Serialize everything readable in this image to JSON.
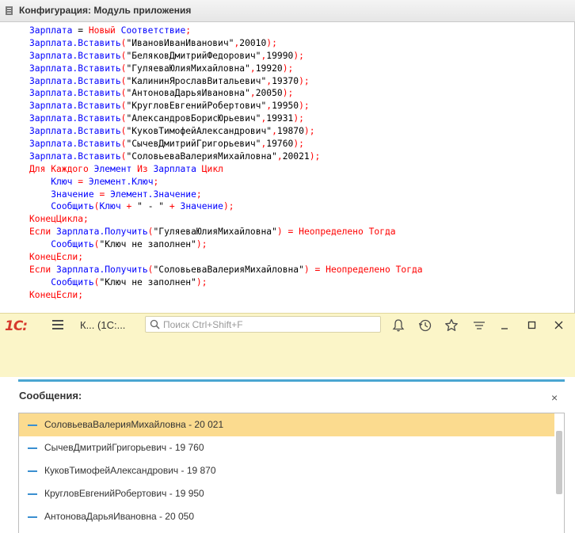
{
  "configurator": {
    "title": "Конфигурация: Модуль приложения",
    "code_lines": [
      [
        {
          "c": "id",
          "t": "Зарплата"
        },
        {
          "c": "st",
          "t": " = "
        },
        {
          "c": "kw",
          "t": "Новый"
        },
        {
          "c": "st",
          "t": " "
        },
        {
          "c": "id",
          "t": "Соответствие"
        },
        {
          "c": "kw",
          "t": ";"
        }
      ],
      [
        {
          "c": "id",
          "t": "Зарплата.Вставить"
        },
        {
          "c": "kw",
          "t": "("
        },
        {
          "c": "st",
          "t": "\"ИвановИванИванович\""
        },
        {
          "c": "kw",
          "t": ","
        },
        {
          "c": "nm",
          "t": "20010"
        },
        {
          "c": "kw",
          "t": ");"
        }
      ],
      [
        {
          "c": "id",
          "t": "Зарплата.Вставить"
        },
        {
          "c": "kw",
          "t": "("
        },
        {
          "c": "st",
          "t": "\"БеляковДмитрийФедорович\""
        },
        {
          "c": "kw",
          "t": ","
        },
        {
          "c": "nm",
          "t": "19990"
        },
        {
          "c": "kw",
          "t": ");"
        }
      ],
      [
        {
          "c": "id",
          "t": "Зарплата.Вставить"
        },
        {
          "c": "kw",
          "t": "("
        },
        {
          "c": "st",
          "t": "\"ГуляеваЮлияМихайловна\""
        },
        {
          "c": "kw",
          "t": ","
        },
        {
          "c": "nm",
          "t": "19920"
        },
        {
          "c": "kw",
          "t": ");"
        }
      ],
      [
        {
          "c": "id",
          "t": "Зарплата.Вставить"
        },
        {
          "c": "kw",
          "t": "("
        },
        {
          "c": "st",
          "t": "\"КалининЯрославВитальевич\""
        },
        {
          "c": "kw",
          "t": ","
        },
        {
          "c": "nm",
          "t": "19370"
        },
        {
          "c": "kw",
          "t": ");"
        }
      ],
      [
        {
          "c": "id",
          "t": "Зарплата.Вставить"
        },
        {
          "c": "kw",
          "t": "("
        },
        {
          "c": "st",
          "t": "\"АнтоноваДарьяИвановна\""
        },
        {
          "c": "kw",
          "t": ","
        },
        {
          "c": "nm",
          "t": "20050"
        },
        {
          "c": "kw",
          "t": ");"
        }
      ],
      [
        {
          "c": "id",
          "t": "Зарплата.Вставить"
        },
        {
          "c": "kw",
          "t": "("
        },
        {
          "c": "st",
          "t": "\"КругловЕвгенийРобертович\""
        },
        {
          "c": "kw",
          "t": ","
        },
        {
          "c": "nm",
          "t": "19950"
        },
        {
          "c": "kw",
          "t": ");"
        }
      ],
      [
        {
          "c": "id",
          "t": "Зарплата.Вставить"
        },
        {
          "c": "kw",
          "t": "("
        },
        {
          "c": "st",
          "t": "\"АлександровБорисЮрьевич\""
        },
        {
          "c": "kw",
          "t": ","
        },
        {
          "c": "nm",
          "t": "19931"
        },
        {
          "c": "kw",
          "t": ");"
        }
      ],
      [
        {
          "c": "id",
          "t": "Зарплата.Вставить"
        },
        {
          "c": "kw",
          "t": "("
        },
        {
          "c": "st",
          "t": "\"КуковТимофейАлександрович\""
        },
        {
          "c": "kw",
          "t": ","
        },
        {
          "c": "nm",
          "t": "19870"
        },
        {
          "c": "kw",
          "t": ");"
        }
      ],
      [
        {
          "c": "id",
          "t": "Зарплата.Вставить"
        },
        {
          "c": "kw",
          "t": "("
        },
        {
          "c": "st",
          "t": "\"СычевДмитрийГригорьевич\""
        },
        {
          "c": "kw",
          "t": ","
        },
        {
          "c": "nm",
          "t": "19760"
        },
        {
          "c": "kw",
          "t": ");"
        }
      ],
      [
        {
          "c": "id",
          "t": "Зарплата.Вставить"
        },
        {
          "c": "kw",
          "t": "("
        },
        {
          "c": "st",
          "t": "\"СоловьеваВалерияМихайловна\""
        },
        {
          "c": "kw",
          "t": ","
        },
        {
          "c": "nm",
          "t": "20021"
        },
        {
          "c": "kw",
          "t": ");"
        }
      ],
      [
        {
          "c": "kw",
          "t": "Для Каждого"
        },
        {
          "c": "st",
          "t": " "
        },
        {
          "c": "id",
          "t": "Элемент"
        },
        {
          "c": "st",
          "t": " "
        },
        {
          "c": "kw",
          "t": "Из"
        },
        {
          "c": "st",
          "t": " "
        },
        {
          "c": "id",
          "t": "Зарплата"
        },
        {
          "c": "st",
          "t": " "
        },
        {
          "c": "kw",
          "t": "Цикл"
        }
      ],
      [
        {
          "c": "st",
          "t": "    "
        },
        {
          "c": "id",
          "t": "Ключ"
        },
        {
          "c": "st",
          "t": " "
        },
        {
          "c": "kw",
          "t": "="
        },
        {
          "c": "st",
          "t": " "
        },
        {
          "c": "id",
          "t": "Элемент.Ключ"
        },
        {
          "c": "kw",
          "t": ";"
        }
      ],
      [
        {
          "c": "st",
          "t": "    "
        },
        {
          "c": "id",
          "t": "Значение"
        },
        {
          "c": "st",
          "t": " "
        },
        {
          "c": "kw",
          "t": "="
        },
        {
          "c": "st",
          "t": " "
        },
        {
          "c": "id",
          "t": "Элемент.Значение"
        },
        {
          "c": "kw",
          "t": ";"
        }
      ],
      [
        {
          "c": "st",
          "t": "    "
        },
        {
          "c": "id",
          "t": "Сообщить"
        },
        {
          "c": "kw",
          "t": "("
        },
        {
          "c": "id",
          "t": "Ключ"
        },
        {
          "c": "st",
          "t": " "
        },
        {
          "c": "kw",
          "t": "+"
        },
        {
          "c": "st",
          "t": " \" - \" "
        },
        {
          "c": "kw",
          "t": "+"
        },
        {
          "c": "st",
          "t": " "
        },
        {
          "c": "id",
          "t": "Значение"
        },
        {
          "c": "kw",
          "t": ");"
        }
      ],
      [
        {
          "c": "kw",
          "t": "КонецЦикла;"
        }
      ],
      [
        {
          "c": "kw",
          "t": "Если"
        },
        {
          "c": "st",
          "t": " "
        },
        {
          "c": "id",
          "t": "Зарплата.Получить"
        },
        {
          "c": "kw",
          "t": "("
        },
        {
          "c": "st",
          "t": "\"ГуляеваЮлияМихайловна\""
        },
        {
          "c": "kw",
          "t": ")"
        },
        {
          "c": "st",
          "t": " "
        },
        {
          "c": "kw",
          "t": "="
        },
        {
          "c": "st",
          "t": " "
        },
        {
          "c": "kw",
          "t": "Неопределено"
        },
        {
          "c": "st",
          "t": " "
        },
        {
          "c": "kw",
          "t": "Тогда"
        }
      ],
      [
        {
          "c": "st",
          "t": "    "
        },
        {
          "c": "id",
          "t": "Сообщить"
        },
        {
          "c": "kw",
          "t": "("
        },
        {
          "c": "st",
          "t": "\"Ключ не заполнен\""
        },
        {
          "c": "kw",
          "t": ");"
        }
      ],
      [
        {
          "c": "kw",
          "t": "КонецЕсли;"
        }
      ],
      [
        {
          "c": "kw",
          "t": "Если"
        },
        {
          "c": "st",
          "t": " "
        },
        {
          "c": "id",
          "t": "Зарплата.Получить"
        },
        {
          "c": "kw",
          "t": "("
        },
        {
          "c": "st",
          "t": "\"СоловьеваВалерияМихайловна\""
        },
        {
          "c": "kw",
          "t": ")"
        },
        {
          "c": "st",
          "t": " "
        },
        {
          "c": "kw",
          "t": "="
        },
        {
          "c": "st",
          "t": " "
        },
        {
          "c": "kw",
          "t": "Неопределено"
        },
        {
          "c": "st",
          "t": " "
        },
        {
          "c": "kw",
          "t": "Тогда"
        }
      ],
      [
        {
          "c": "st",
          "t": "    "
        },
        {
          "c": "id",
          "t": "Сообщить"
        },
        {
          "c": "kw",
          "t": "("
        },
        {
          "c": "st",
          "t": "\"Ключ не заполнен\""
        },
        {
          "c": "kw",
          "t": ");"
        }
      ],
      [
        {
          "c": "kw",
          "t": "КонецЕсли;"
        }
      ]
    ]
  },
  "client": {
    "logo": "1С:",
    "tab_label": "К...  (1С:...",
    "search_placeholder": "Поиск Ctrl+Shift+F",
    "messages_title": "Сообщения:",
    "close_glyph": "×",
    "messages": [
      {
        "text": "СоловьеваВалерияМихайловна - 20 021",
        "selected": true
      },
      {
        "text": "СычевДмитрийГригорьевич - 19 760",
        "selected": false
      },
      {
        "text": "КуковТимофейАлександрович - 19 870",
        "selected": false
      },
      {
        "text": "КругловЕвгенийРобертович - 19 950",
        "selected": false
      },
      {
        "text": "АнтоноваДарьяИвановна - 20 050",
        "selected": false
      }
    ]
  },
  "colors": {
    "identifier": "#0000ff",
    "keyword": "#ff0000",
    "toolbar": "#fbf5c8",
    "accent": "#4aa5d1",
    "selection": "#fbdb8f"
  }
}
